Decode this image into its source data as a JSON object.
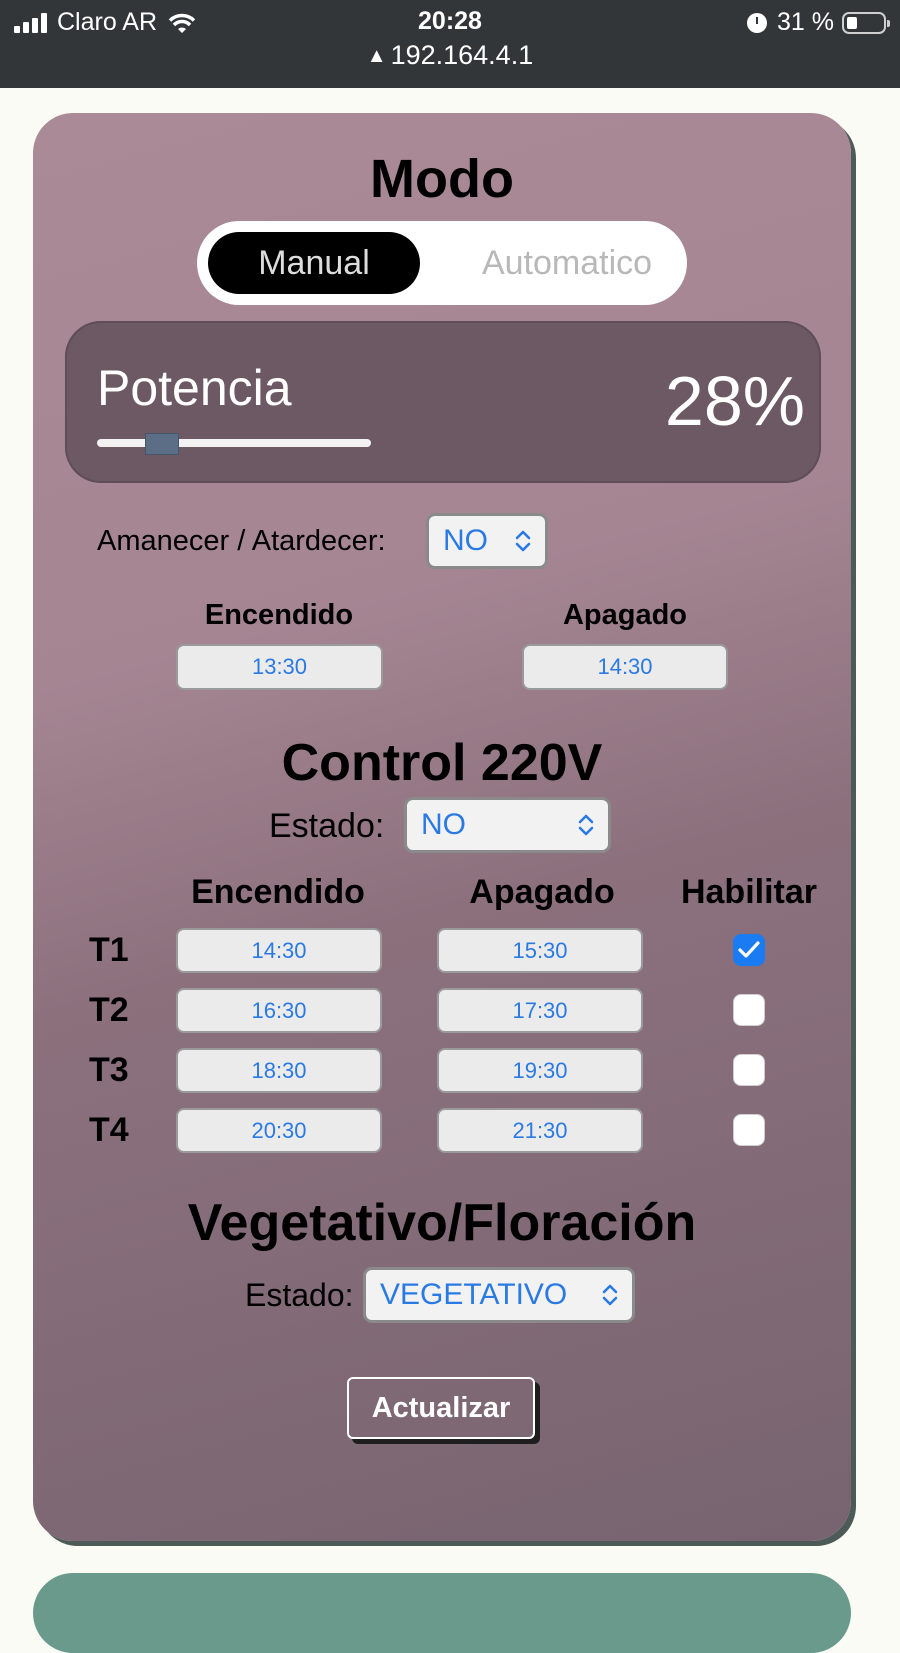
{
  "status_bar": {
    "carrier": "Claro AR",
    "time": "20:28",
    "url": "192.164.4.1",
    "battery": "31 %"
  },
  "modo": {
    "title": "Modo",
    "options": [
      "Manual",
      "Automatico"
    ],
    "selected": "Manual"
  },
  "potencia": {
    "label": "Potencia",
    "value_text": "28%",
    "value": 0.28
  },
  "amanecer": {
    "label": "Amanecer / Atardecer:",
    "value": "NO"
  },
  "luz": {
    "on_label": "Encendido",
    "off_label": "Apagado",
    "on_time": "13:30",
    "off_time": "14:30"
  },
  "control": {
    "title": "Control 220V",
    "estado_label": "Estado:",
    "estado_value": "NO",
    "headers": [
      "Encendido",
      "Apagado",
      "Habilitar"
    ],
    "rows": [
      {
        "label": "T1",
        "on": "14:30",
        "off": "15:30",
        "enabled": true
      },
      {
        "label": "T2",
        "on": "16:30",
        "off": "17:30",
        "enabled": false
      },
      {
        "label": "T3",
        "on": "18:30",
        "off": "19:30",
        "enabled": false
      },
      {
        "label": "T4",
        "on": "20:30",
        "off": "21:30",
        "enabled": false
      }
    ]
  },
  "vegetativo": {
    "title": "Vegetativo/Floración",
    "estado_label": "Estado:",
    "estado_value": "VEGETATIVO"
  },
  "actions": {
    "update_label": "Actualizar"
  },
  "colors": {
    "accent": "#2a7ae4",
    "card_bg": "#a58592",
    "panel_bg": "#6d5963"
  }
}
